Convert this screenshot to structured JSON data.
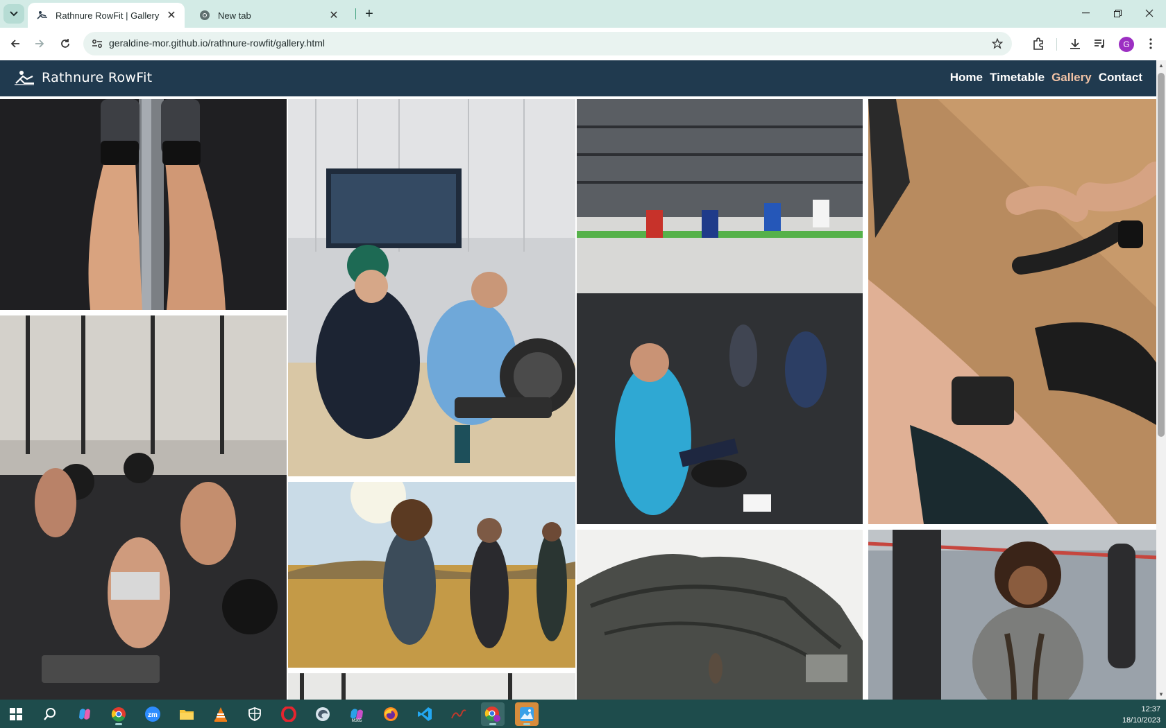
{
  "browser": {
    "tabs": [
      {
        "title": "Rathnure RowFit | Gallery",
        "active": true
      },
      {
        "title": "New tab",
        "active": false
      }
    ],
    "url": "geraldine-mor.github.io/rathnure-rowfit/gallery.html",
    "profile_initial": "G"
  },
  "site": {
    "brand": "Rathnure RowFit",
    "nav": [
      "Home",
      "Timetable",
      "Gallery",
      "Contact"
    ],
    "current_page": "Gallery"
  },
  "gallery": [
    {
      "subject": "legs on rowing machine"
    },
    {
      "subject": "rowing competition coach and athlete"
    },
    {
      "subject": "group stretching class in gym"
    },
    {
      "subject": "hands on rowing handle"
    },
    {
      "subject": "crossfit class with medicine balls"
    },
    {
      "subject": "hikers in golden field"
    },
    {
      "subject": "person climbing rock outcrop"
    },
    {
      "subject": "woman with battle ropes"
    },
    {
      "subject": "gym interior"
    }
  ],
  "taskbar": {
    "time": "12:37",
    "date": "18/10/2023",
    "apps": [
      "start-icon",
      "search-icon",
      "copilot-icon",
      "chrome-icon",
      "zoom-icon",
      "file-explorer-icon",
      "vlc-icon",
      "security-icon",
      "opera-icon",
      "edge-icon",
      "m365-icon",
      "firefox-icon",
      "vscode-icon",
      "scribble-icon",
      "chrome-profile-icon",
      "photos-icon"
    ]
  },
  "colors": {
    "nav_bg": "#203a4f",
    "nav_current": "#f0c2a5",
    "tabstrip": "#d3ebe6",
    "taskbar": "#1e4c4c"
  }
}
